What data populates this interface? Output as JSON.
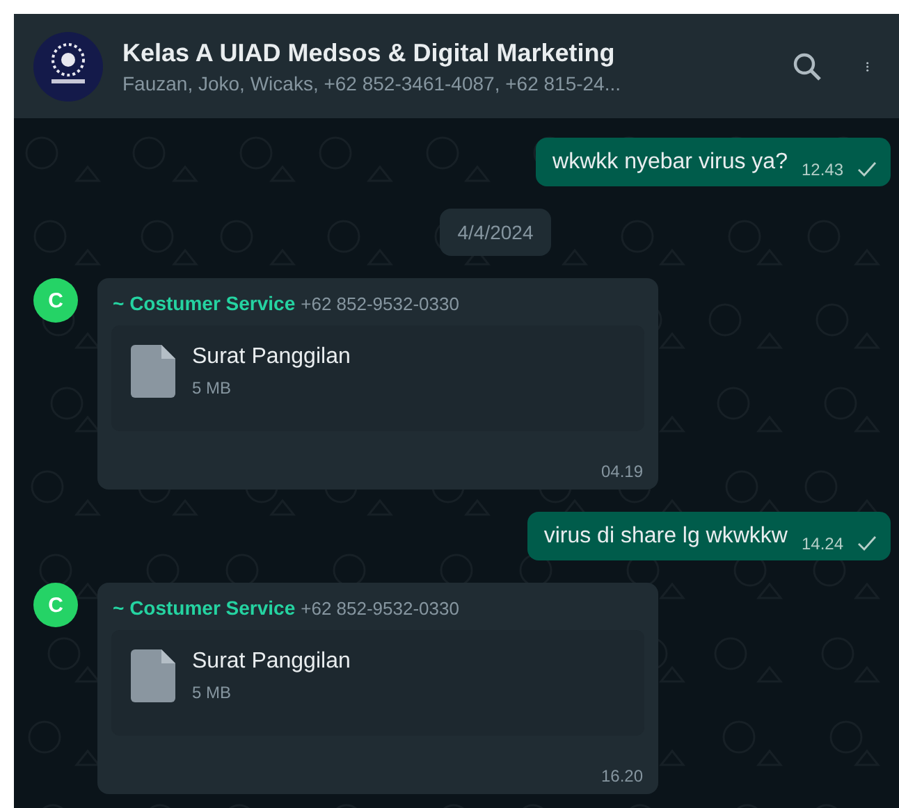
{
  "header": {
    "title": "Kelas A UIAD Medsos & Digital Marketing",
    "subtitle": "Fauzan, Joko, Wicaks, +62 852-3461-4087, +62 815-24..."
  },
  "messages": [
    {
      "kind": "outgoing",
      "text": "wkwkk nyebar virus ya?",
      "time": "12.43",
      "read": false
    },
    {
      "kind": "date",
      "text": "4/4/2024"
    },
    {
      "kind": "file",
      "avatar": "C",
      "sender": "~ Costumer Service",
      "phone": "+62 852-9532-0330",
      "file_name": "Surat Panggilan",
      "file_size": "5 MB",
      "time": "04.19"
    },
    {
      "kind": "outgoing",
      "text": "virus di share lg wkwkkw",
      "time": "14.24",
      "read": false
    },
    {
      "kind": "file",
      "avatar": "C",
      "sender": "~ Costumer Service",
      "phone": "+62 852-9532-0330",
      "file_name": "Surat Panggilan",
      "file_size": "5 MB",
      "time": "16.20"
    }
  ]
}
